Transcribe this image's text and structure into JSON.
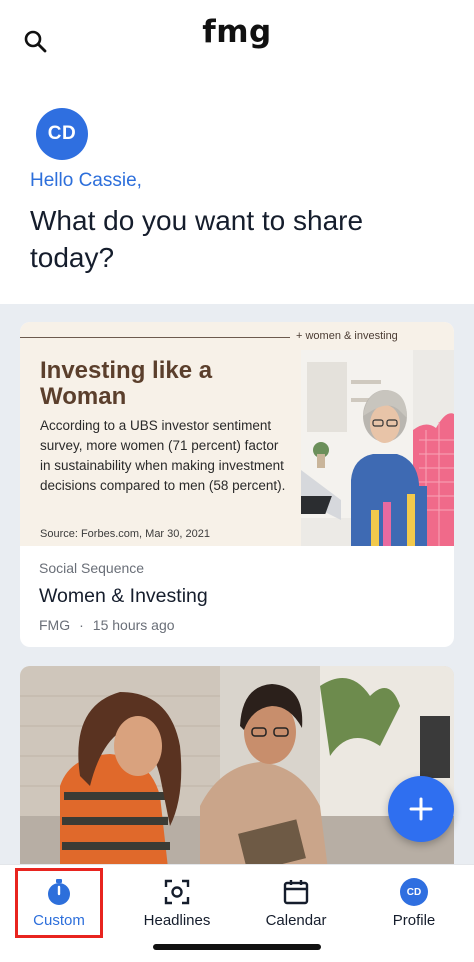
{
  "app": {
    "logo_text": "fmg"
  },
  "greeting": {
    "avatar_initials": "CD",
    "hello": "Hello Cassie,",
    "question": "What do you want to share today?"
  },
  "cards": [
    {
      "promo": {
        "tag": "+ women & investing",
        "title": "Investing like a Woman",
        "body": "According to a UBS investor sentiment survey, more women (71 percent) factor in sustainability when making investment decisions compared to men (58 percent).",
        "source": "Source: Forbes.com, Mar 30, 2021"
      },
      "type": "Social Sequence",
      "title": "Women & Investing",
      "author": "FMG",
      "time": "15 hours ago"
    }
  ],
  "fab": {
    "icon": "plus-icon"
  },
  "tabs": [
    {
      "label": "Custom",
      "icon": "stopwatch-icon",
      "active": true
    },
    {
      "label": "Headlines",
      "icon": "scan-icon",
      "active": false
    },
    {
      "label": "Calendar",
      "icon": "calendar-icon",
      "active": false
    },
    {
      "label": "Profile",
      "icon": "avatar",
      "initials": "CD",
      "active": false
    }
  ],
  "colors": {
    "accent": "#2f6fe0",
    "highlight": "#e8241f",
    "feed_background": "#e9edf2"
  }
}
